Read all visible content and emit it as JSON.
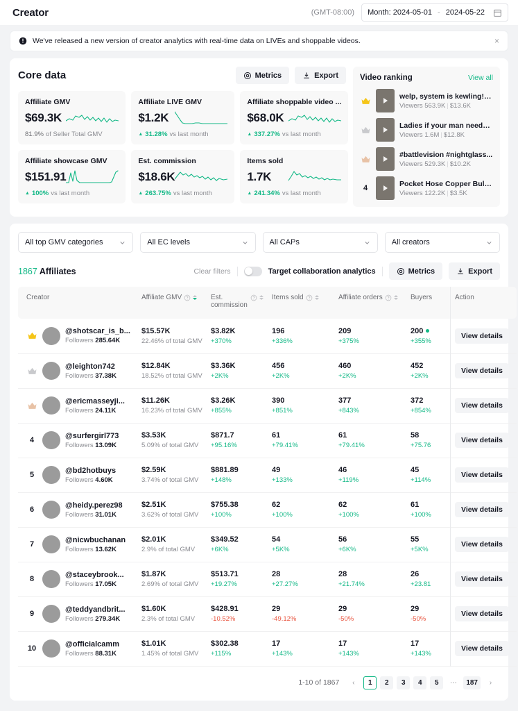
{
  "header": {
    "title": "Creator",
    "timezone": "(GMT-08:00)",
    "date_start": "Month: 2024-05-01",
    "date_sep": "-",
    "date_end": "2024-05-22",
    "calendar_icon": "calendar-icon"
  },
  "banner": {
    "icon": "info-icon",
    "text": "We've released a new version of creator analytics with real-time data on LIVEs and shoppable videos.",
    "close": "×"
  },
  "core": {
    "title": "Core data",
    "metrics_label": "Metrics",
    "export_label": "Export",
    "cards": [
      {
        "label": "Affiliate GMV",
        "value": "$69.3K",
        "foot_value": "81.9%",
        "foot_text": "of Seller Total GMV",
        "trend": "none",
        "spark": "0,16 5,13 10,15 14,9 19,11 23,8 27,14 31,10 35,15 39,11 43,16 47,12 51,17 55,12 59,18 63,13 67,17 71,15 76,16"
      },
      {
        "label": "Affiliate LIVE GMV",
        "value": "$1.2K",
        "foot_value": "31.28%",
        "foot_text": "vs last month",
        "trend": "up",
        "spark": "0,3 4,9 8,15 11,19 15,20 20,20 25,20 30,19 35,19 40,20 45,20 50,20 55,20 60,20 66,20 71,20 76,20"
      },
      {
        "label": "Affiliate shoppable video ...",
        "value": "$68.0K",
        "foot_value": "337.27%",
        "foot_text": "vs last month",
        "trend": "up",
        "spark": "0,16 5,13 10,15 14,9 19,11 23,8 27,14 31,10 35,15 39,11 43,16 47,12 51,17 55,12 59,18 63,13 67,17 71,15 76,16"
      },
      {
        "label": "Affiliate showcase GMV",
        "value": "$151.91",
        "foot_value": "100%",
        "foot_text": "vs last month",
        "trend": "up",
        "spark": "0,20 4,20 7,6 10,18 13,3 16,17 20,20 26,20 34,20 42,20 50,20 58,20 63,20 66,19 69,12 72,5 75,3"
      },
      {
        "label": "Est. commission",
        "value": "$18.6K",
        "foot_value": "263.75%",
        "foot_text": "vs last month",
        "trend": "up",
        "spark": "0,15 4,10 8,5 12,9 16,7 20,11 24,8 28,12 32,10 36,13 40,11 44,15 48,12 52,16 56,13 60,17 64,14 70,16 76,15"
      },
      {
        "label": "Items sold",
        "value": "1.7K",
        "foot_value": "241.34%",
        "foot_text": "vs last month",
        "trend": "up",
        "spark": "0,17 4,11 8,4 12,9 16,7 20,12 24,10 28,13 32,11 36,14 40,12 44,15 48,13 52,16 56,14 60,16 64,15 70,16 76,16"
      }
    ]
  },
  "video_ranking": {
    "title": "Video ranking",
    "view_all": "View all",
    "items": [
      {
        "rank": "1",
        "rank_icon": "gold-crown-icon",
        "title": "welp, system is kewling! #...",
        "viewers_label": "Viewers",
        "viewers": "563.9K",
        "gmv": "$13.6K"
      },
      {
        "rank": "2",
        "rank_icon": "silver-crown-icon",
        "title": "Ladies if your man needs ...",
        "viewers_label": "Viewers",
        "viewers": "1.6M",
        "gmv": "$12.8K"
      },
      {
        "rank": "3",
        "rank_icon": "bronze-crown-icon",
        "title": "#battlevision #nightglass...",
        "viewers_label": "Viewers",
        "viewers": "529.3K",
        "gmv": "$10.2K"
      },
      {
        "rank": "4",
        "rank_icon": "number",
        "title": "Pocket Hose Copper Bulle...",
        "viewers_label": "Viewers",
        "viewers": "122.2K",
        "gmv": "$3.5K"
      }
    ]
  },
  "filters": [
    {
      "label": "All top GMV categories",
      "name": "filter-gmv-categories"
    },
    {
      "label": "All EC levels",
      "name": "filter-ec-levels"
    },
    {
      "label": "All CAPs",
      "name": "filter-caps"
    },
    {
      "label": "All creators",
      "name": "filter-creators"
    }
  ],
  "table_bar": {
    "count": "1867",
    "count_label": "Affiliates",
    "clear_filters": "Clear filters",
    "toggle_label": "Target collaboration analytics",
    "toggle_state": "off",
    "metrics_label": "Metrics",
    "export_label": "Export"
  },
  "table": {
    "columns": [
      {
        "label": "Creator",
        "help": false,
        "sortable": false
      },
      {
        "label": "Affiliate GMV",
        "help": true,
        "sortable": true,
        "sorted": "desc"
      },
      {
        "label": "Est. commission",
        "help": true,
        "sortable": true,
        "sorted": "none"
      },
      {
        "label": "Items sold",
        "help": true,
        "sortable": true,
        "sorted": "none"
      },
      {
        "label": "Affiliate orders",
        "help": true,
        "sortable": true,
        "sorted": "none"
      },
      {
        "label": "Buyers",
        "help": false,
        "sortable": false
      },
      {
        "label": "Action",
        "help": false,
        "sortable": false
      }
    ],
    "action_label": "View details",
    "rows": [
      {
        "rank": "1",
        "rank_icon": "gold-crown-icon",
        "handle": "@shotscar_is_b...",
        "followers_label": "Followers",
        "followers": "285.64K",
        "gmv": "$15.57K",
        "gmv_sub": "22.46% of total GMV",
        "commission": "$3.82K",
        "commission_sub": "+370%",
        "commission_dir": "up",
        "items": "196",
        "items_sub": "+336%",
        "items_dir": "up",
        "orders": "209",
        "orders_sub": "+375%",
        "orders_dir": "up",
        "buyers": "200",
        "buyers_sub": "+355%",
        "buyers_dir": "up",
        "buyers_dot": true
      },
      {
        "rank": "2",
        "rank_icon": "silver-crown-icon",
        "handle": "@leighton742",
        "followers_label": "Followers",
        "followers": "37.38K",
        "gmv": "$12.84K",
        "gmv_sub": "18.52% of total GMV",
        "commission": "$3.36K",
        "commission_sub": "+2K%",
        "commission_dir": "up",
        "items": "456",
        "items_sub": "+2K%",
        "items_dir": "up",
        "orders": "460",
        "orders_sub": "+2K%",
        "orders_dir": "up",
        "buyers": "452",
        "buyers_sub": "+2K%",
        "buyers_dir": "up",
        "buyers_dot": false
      },
      {
        "rank": "3",
        "rank_icon": "bronze-crown-icon",
        "handle": "@ericmasseyji...",
        "followers_label": "Followers",
        "followers": "24.11K",
        "gmv": "$11.26K",
        "gmv_sub": "16.23% of total GMV",
        "commission": "$3.26K",
        "commission_sub": "+855%",
        "commission_dir": "up",
        "items": "390",
        "items_sub": "+851%",
        "items_dir": "up",
        "orders": "377",
        "orders_sub": "+843%",
        "orders_dir": "up",
        "buyers": "372",
        "buyers_sub": "+854%",
        "buyers_dir": "up",
        "buyers_dot": false
      },
      {
        "rank": "4",
        "rank_icon": "number",
        "handle": "@surfergirl773",
        "followers_label": "Followers",
        "followers": "13.09K",
        "gmv": "$3.53K",
        "gmv_sub": "5.09% of total GMV",
        "commission": "$871.7",
        "commission_sub": "+95.16%",
        "commission_dir": "up",
        "items": "61",
        "items_sub": "+79.41%",
        "items_dir": "up",
        "orders": "61",
        "orders_sub": "+79.41%",
        "orders_dir": "up",
        "buyers": "58",
        "buyers_sub": "+75.76",
        "buyers_dir": "up",
        "buyers_dot": false
      },
      {
        "rank": "5",
        "rank_icon": "number",
        "handle": "@bd2hotbuys",
        "followers_label": "Followers",
        "followers": "4.60K",
        "gmv": "$2.59K",
        "gmv_sub": "3.74% of total GMV",
        "commission": "$881.89",
        "commission_sub": "+148%",
        "commission_dir": "up",
        "items": "49",
        "items_sub": "+133%",
        "items_dir": "up",
        "orders": "46",
        "orders_sub": "+119%",
        "orders_dir": "up",
        "buyers": "45",
        "buyers_sub": "+114%",
        "buyers_dir": "up",
        "buyers_dot": false
      },
      {
        "rank": "6",
        "rank_icon": "number",
        "handle": "@heidy.perez98",
        "followers_label": "Followers",
        "followers": "31.01K",
        "gmv": "$2.51K",
        "gmv_sub": "3.62% of total GMV",
        "commission": "$755.38",
        "commission_sub": "+100%",
        "commission_dir": "up",
        "items": "62",
        "items_sub": "+100%",
        "items_dir": "up",
        "orders": "62",
        "orders_sub": "+100%",
        "orders_dir": "up",
        "buyers": "61",
        "buyers_sub": "+100%",
        "buyers_dir": "up",
        "buyers_dot": false
      },
      {
        "rank": "7",
        "rank_icon": "number",
        "handle": "@nicwbuchanan",
        "followers_label": "Followers",
        "followers": "13.62K",
        "gmv": "$2.01K",
        "gmv_sub": "2.9% of total GMV",
        "commission": "$349.52",
        "commission_sub": "+6K%",
        "commission_dir": "up",
        "items": "54",
        "items_sub": "+5K%",
        "items_dir": "up",
        "orders": "56",
        "orders_sub": "+6K%",
        "orders_dir": "up",
        "buyers": "55",
        "buyers_sub": "+5K%",
        "buyers_dir": "up",
        "buyers_dot": false
      },
      {
        "rank": "8",
        "rank_icon": "number",
        "handle": "@staceybrook...",
        "followers_label": "Followers",
        "followers": "17.05K",
        "gmv": "$1.87K",
        "gmv_sub": "2.69% of total GMV",
        "commission": "$513.71",
        "commission_sub": "+19.27%",
        "commission_dir": "up",
        "items": "28",
        "items_sub": "+27.27%",
        "items_dir": "up",
        "orders": "28",
        "orders_sub": "+21.74%",
        "orders_dir": "up",
        "buyers": "26",
        "buyers_sub": "+23.81",
        "buyers_dir": "up",
        "buyers_dot": false
      },
      {
        "rank": "9",
        "rank_icon": "number",
        "handle": "@teddyandbrit...",
        "followers_label": "Followers",
        "followers": "279.34K",
        "gmv": "$1.60K",
        "gmv_sub": "2.3% of total GMV",
        "commission": "$428.91",
        "commission_sub": "-10.52%",
        "commission_dir": "dn",
        "items": "29",
        "items_sub": "-49.12%",
        "items_dir": "dn",
        "orders": "29",
        "orders_sub": "-50%",
        "orders_dir": "dn",
        "buyers": "29",
        "buyers_sub": "-50%",
        "buyers_dir": "dn",
        "buyers_dot": false
      },
      {
        "rank": "10",
        "rank_icon": "number",
        "handle": "@officialcamm",
        "followers_label": "Followers",
        "followers": "88.31K",
        "gmv": "$1.01K",
        "gmv_sub": "1.45% of total GMV",
        "commission": "$302.38",
        "commission_sub": "+115%",
        "commission_dir": "up",
        "items": "17",
        "items_sub": "+143%",
        "items_dir": "up",
        "orders": "17",
        "orders_sub": "+143%",
        "orders_dir": "up",
        "buyers": "17",
        "buyers_sub": "+143%",
        "buyers_dir": "up",
        "buyers_dot": false
      }
    ]
  },
  "pagination": {
    "info": "1-10 of 1867",
    "prev": "‹",
    "next": "›",
    "pages": [
      "1",
      "2",
      "3",
      "4",
      "5"
    ],
    "dots": "···",
    "last": "187",
    "active": "1"
  },
  "colors": {
    "accent_green": "#12b886",
    "negative_red": "#e8543f",
    "page_bg": "#f2f3f5"
  }
}
